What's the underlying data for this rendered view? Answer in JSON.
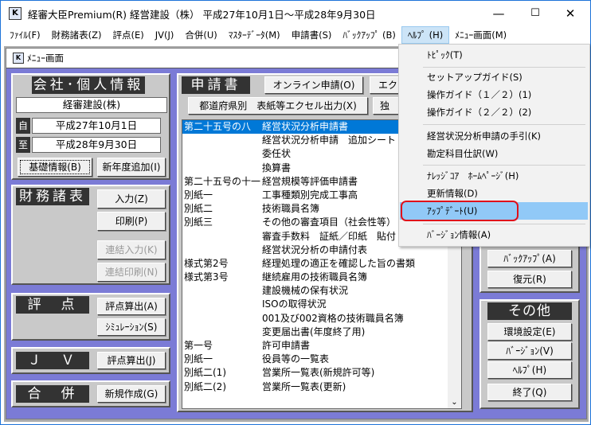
{
  "window": {
    "title": "経審大臣Premium(R) 経営建設（株） 平成27年10月1日～平成28年9月30日",
    "minimize": "—",
    "maximize": "☐",
    "close": "✕",
    "icon": "app-icon"
  },
  "menubar": [
    "ﾌｧｲﾙ(F)",
    "財務諸表(Z)",
    "評点(E)",
    "JV(J)",
    "合併(U)",
    "ﾏｽﾀｰﾃﾞｰﾀ(M)",
    "申請書(S)",
    "ﾊﾞｯｸｱｯﾌﾟ (B)",
    "ﾍﾙﾌﾟ (H)",
    "ﾒﾆｭｰ画面(M)"
  ],
  "child": {
    "title": "ﾒﾆｭｰ画面"
  },
  "company": {
    "header": "会社･個人情報",
    "name": "経審建設(株)",
    "from_label": "自",
    "from_date": "平成27年10月1日",
    "to_label": "至",
    "to_date": "平成28年9月30日",
    "basic_btn": "基礎情報(B)",
    "new_year_btn": "新年度追加(I)"
  },
  "finance": {
    "header": "財務諸表",
    "input": "入力(Z)",
    "print": "印刷(P)",
    "link_input": "連結入力(K)",
    "link_print": "連結印刷(N)"
  },
  "score": {
    "header": "評　点",
    "calc": "評点算出(A)",
    "sim": "ｼﾐｭﾚｰｼｮﾝ(S)"
  },
  "jv": {
    "header": "Ｊ　Ｖ",
    "calc": "評点算出(J)"
  },
  "merge": {
    "header": "合　併",
    "create": "新規作成(G)"
  },
  "app": {
    "header": "申請書",
    "online": "オンライン申請(O)",
    "ex": "エク",
    "pref": "都道府県別　表紙等エクセル出力(X)",
    "oth": "独"
  },
  "rows": [
    [
      "第二十五号の八",
      "経営状況分析申請書"
    ],
    [
      "",
      "経営状況分析申請　追加シート"
    ],
    [
      "",
      "委任状"
    ],
    [
      "",
      "換算書"
    ],
    [
      "第二十五号の十一",
      "経営規模等評価申請書"
    ],
    [
      "別紙一",
      "工事種類別完成工事高"
    ],
    [
      "別紙二",
      "技術職員名簿"
    ],
    [
      "別紙三",
      "その他の審査項目（社会性等）"
    ],
    [
      "",
      "審査手数料　証紙／印紙　貼付"
    ],
    [
      "",
      "経営状況分析の申請付表"
    ],
    [
      "様式第2号",
      "経理処理の適正を確認した旨の書類"
    ],
    [
      "様式第3号",
      "継続雇用の技術職員名簿"
    ],
    [
      "",
      "建設機械の保有状況"
    ],
    [
      "",
      "ISOの取得状況"
    ],
    [
      "",
      "001及び002資格の技術職員名簿"
    ],
    [
      "",
      "変更届出書(年度終了用)"
    ],
    [
      "第一号",
      "許可申請書"
    ],
    [
      "別紙一",
      "役員等の一覧表"
    ],
    [
      "別紙二(1)",
      "営業所一覧表(新規許可等)"
    ],
    [
      "別紙二(2)",
      "営業所一覧表(更新)"
    ]
  ],
  "backup": {
    "backup": "ﾊﾞｯｸｱｯﾌﾟ(A)",
    "restore": "復元(R)"
  },
  "other": {
    "header": "その他",
    "env": "環境設定(E)",
    "version": "ﾊﾞｰｼﾞｮﾝ(V)",
    "help": "ﾍﾙﾌﾟ(H)",
    "exit": "終了(Q)"
  },
  "help_menu": [
    "ﾄﾋﾟｯｸ(T)",
    "セットアップガイド(S)",
    "操作ガイド（１／２）(1)",
    "操作ガイド（２／２）(2)",
    "経営状況分析申請の手引(K)",
    "勘定科目仕訳(W)",
    "ﾅﾚｯｼﾞｺｱ　ﾎｰﾑﾍﾟｰｼﾞ(H)",
    "更新情報(D)",
    "ｱｯﾌﾟﾃﾞｰﾄ(U)",
    "ﾊﾞｰｼﾞｮﾝ情報(A)"
  ]
}
